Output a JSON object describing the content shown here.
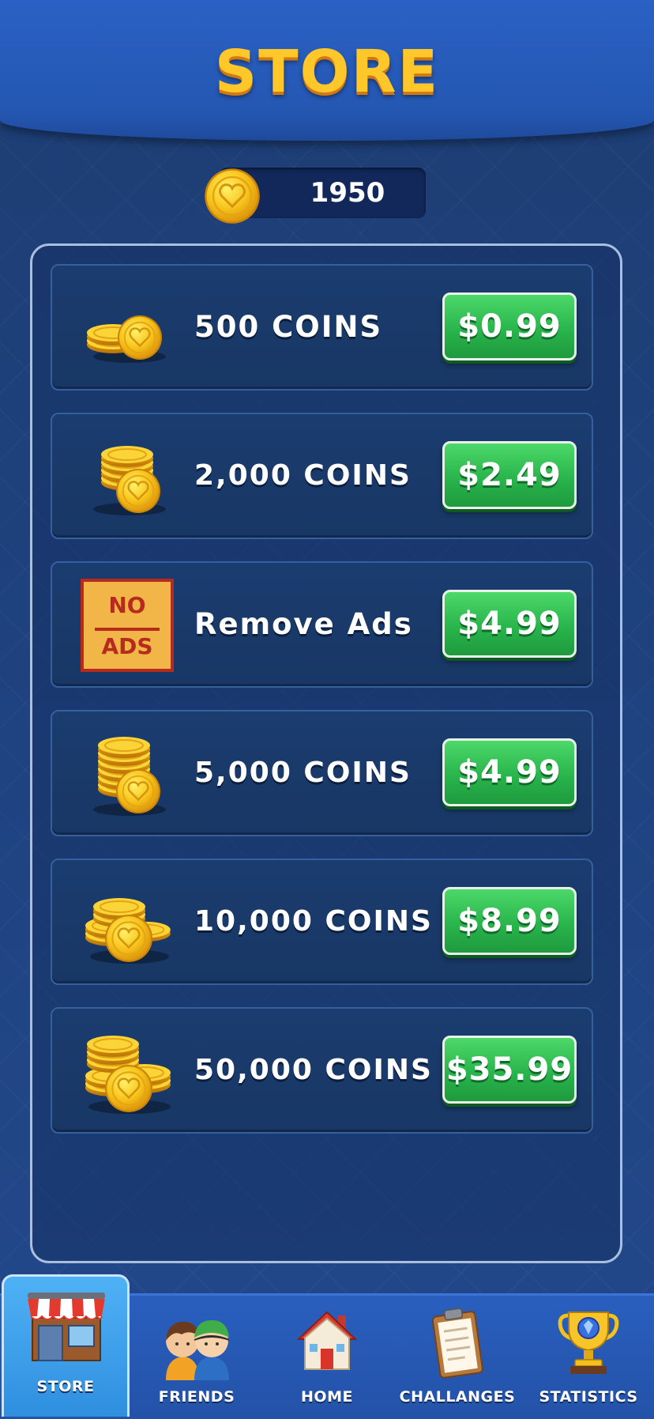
{
  "header": {
    "title": "STORE"
  },
  "balance": {
    "coin_icon": "heart-coin-icon",
    "value": "1950"
  },
  "store": {
    "items": [
      {
        "label": "500 COINS",
        "price": "$0.99",
        "icon": "coins-small-icon"
      },
      {
        "label": "2,000 COINS",
        "price": "$2.49",
        "icon": "coins-stack-icon"
      },
      {
        "label": "Remove Ads",
        "price": "$4.99",
        "icon": "no-ads-icon",
        "icon_text_top": "NO",
        "icon_text_bottom": "ADS"
      },
      {
        "label": "5,000 COINS",
        "price": "$4.99",
        "icon": "coins-tall-stack-icon"
      },
      {
        "label": "10,000 COINS",
        "price": "$8.99",
        "icon": "coins-pile-icon"
      },
      {
        "label": "50,000 COINS",
        "price": "$35.99",
        "icon": "coins-big-pile-icon"
      }
    ]
  },
  "nav": {
    "items": [
      {
        "label": "STORE",
        "icon": "shop-icon",
        "active": true
      },
      {
        "label": "FRIENDS",
        "icon": "friends-icon",
        "active": false
      },
      {
        "label": "HOME",
        "icon": "house-icon",
        "active": false
      },
      {
        "label": "CHALLANGES",
        "icon": "clipboard-icon",
        "active": false
      },
      {
        "label": "STATISTICS",
        "icon": "trophy-icon",
        "active": false
      }
    ]
  },
  "colors": {
    "title": "#ffc72a",
    "price_button": "#27b24a",
    "coin": "#f7c21b",
    "nav_active": "#3a9be8",
    "background": "#1f4381"
  }
}
